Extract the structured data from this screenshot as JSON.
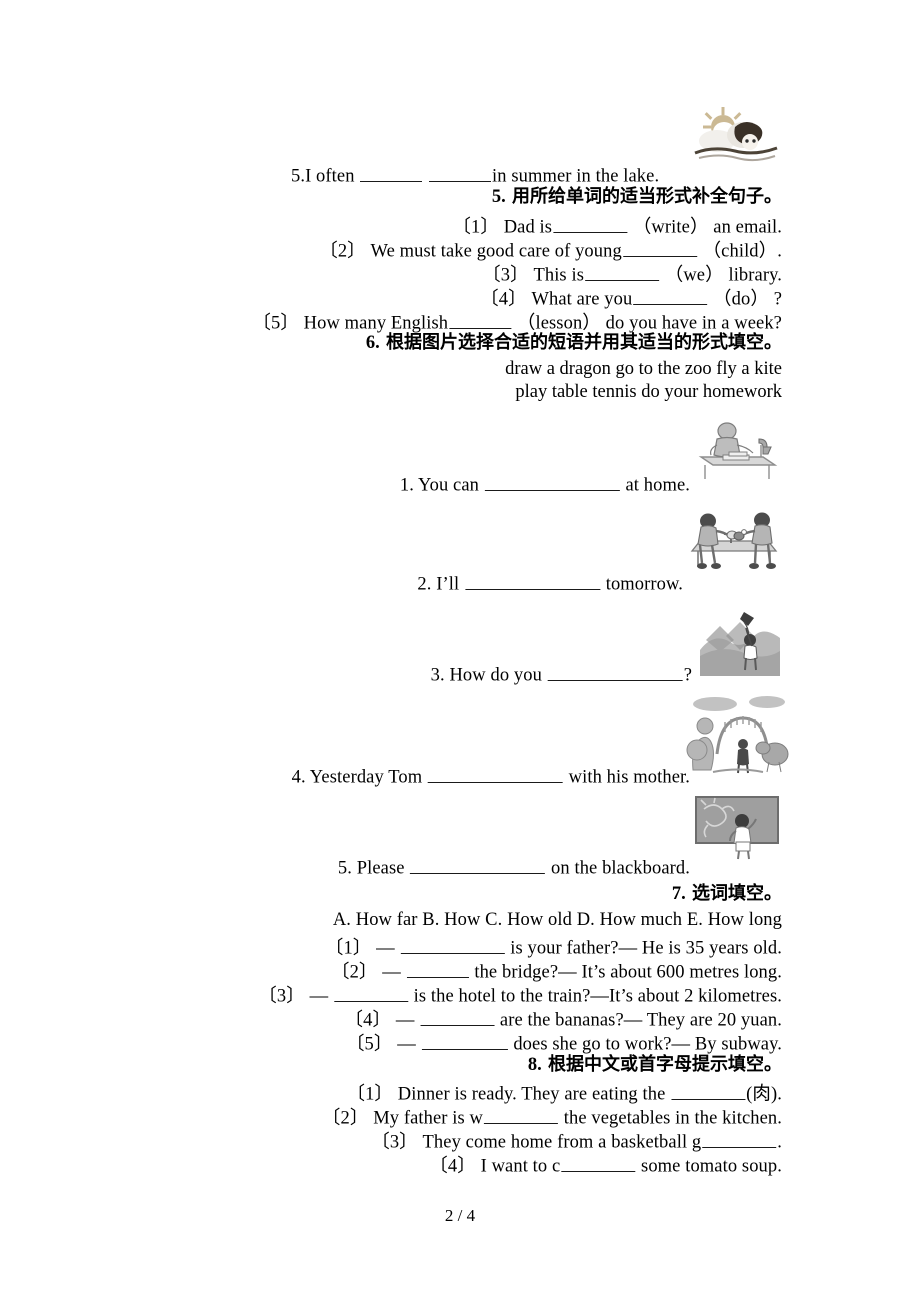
{
  "document": {
    "page_label": "2 / 4",
    "language": "en-zh"
  },
  "carryover": {
    "item5_text_before": "5.I often",
    "item5_text_after": "in summer in the lake."
  },
  "section5": {
    "number": "5.",
    "title": "用所给单词的适当形式补全句子。",
    "items": [
      {
        "marker": "〔1〕",
        "before": "Dad is",
        "after": "（write）",
        "tail": "an email."
      },
      {
        "marker": "〔2〕",
        "before": "We must take good care of young",
        "after": "（child）",
        "tail": "."
      },
      {
        "marker": "〔3〕",
        "before": "This is",
        "after": "（we）",
        "tail": "library."
      },
      {
        "marker": "〔4〕",
        "before": "What are you",
        "after": "（do）",
        "tail": "?"
      },
      {
        "marker": "〔5〕",
        "before": "How many English",
        "after": "（lesson）",
        "tail": "do you have in a week?"
      }
    ]
  },
  "section6": {
    "number": "6.",
    "title": "根据图片选择合适的短语并用其适当的形式填空。",
    "word_bank_line1": "draw a dragon go to the zoo fly a kite",
    "word_bank_line2": "play table tennis do your homework",
    "items": [
      {
        "marker": "1.",
        "before": "You can",
        "after": "at home.",
        "picture": "homework-desk-illustration"
      },
      {
        "marker": "2.",
        "before": "I’ll",
        "after": "tomorrow.",
        "picture": "table-tennis-illustration"
      },
      {
        "marker": "3.",
        "before": "How do you",
        "after": "?",
        "picture": "kite-flying-illustration"
      },
      {
        "marker": "4.",
        "before": "Yesterday Tom",
        "after": "with his mother.",
        "picture": "zoo-entrance-illustration"
      },
      {
        "marker": "5.",
        "before": "Please",
        "after": "on the blackboard.",
        "picture": "blackboard-drawing-illustration"
      }
    ]
  },
  "section7": {
    "number": "7.",
    "title": "选词填空。",
    "options": "A. How far   B. How   C. How old   D. How much   E. How long",
    "items": [
      {
        "marker": "〔1〕",
        "dash": "—",
        "after": "is your father?— He is 35 years old."
      },
      {
        "marker": "〔2〕",
        "dash": "—",
        "after": "the bridge?— It’s about 600 metres long."
      },
      {
        "marker": "〔3〕",
        "dash": "—",
        "after": "is the hotel to the train?—It’s about 2 kilometres."
      },
      {
        "marker": "〔4〕",
        "dash": "—",
        "after": "are the bananas?— They are 20 yuan."
      },
      {
        "marker": "〔5〕",
        "dash": "—",
        "after": "does she go to work?— By subway."
      }
    ]
  },
  "section8": {
    "number": "8.",
    "title": "根据中文或首字母提示填空。",
    "items": [
      {
        "marker": "〔1〕",
        "before": "Dinner is ready. They are eating the",
        "after": "(肉)."
      },
      {
        "marker": "〔2〕",
        "before": "My father is w",
        "after": "the vegetables in the kitchen."
      },
      {
        "marker": "〔3〕",
        "before": "They come home from a basketball g",
        "after": "."
      },
      {
        "marker": "〔4〕",
        "before": "I want to c",
        "after": "some tomato soup."
      }
    ]
  },
  "illustrations": {
    "swimming": "swimming-in-lake-illustration",
    "homework": "homework-desk-illustration",
    "tabletennis": "table-tennis-illustration",
    "kite": "kite-flying-illustration",
    "zoo": "zoo-entrance-illustration",
    "blackboard": "blackboard-drawing-illustration"
  },
  "colors": {
    "text": "#000000",
    "rule": "#1a1a1a",
    "illustration_gray": "#9a9a9a",
    "page_background": "#ffffff"
  }
}
